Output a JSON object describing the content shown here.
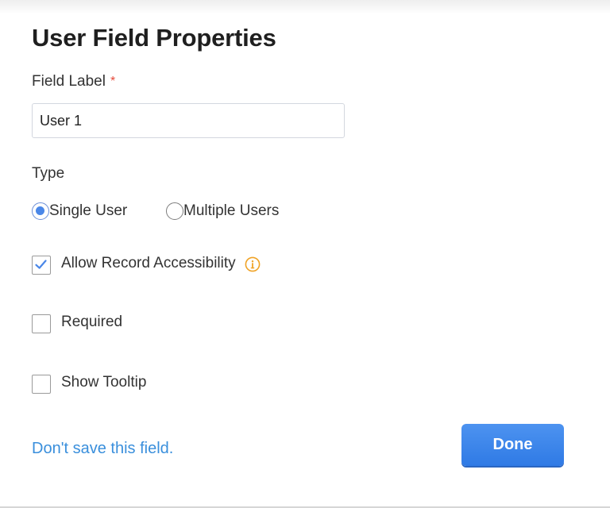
{
  "dialog": {
    "title": "User Field Properties"
  },
  "field_label": {
    "label": "Field Label",
    "required_marker": "*",
    "value": "User 1"
  },
  "type": {
    "label": "Type",
    "options": [
      {
        "label": "Single User",
        "selected": true
      },
      {
        "label": "Multiple Users",
        "selected": false
      }
    ]
  },
  "options": {
    "allow_record_accessibility": {
      "label": "Allow Record Accessibility",
      "checked": true,
      "icon": "info-icon"
    },
    "required": {
      "label": "Required",
      "checked": false
    },
    "show_tooltip": {
      "label": "Show Tooltip",
      "checked": false
    }
  },
  "footer": {
    "dont_save_link": "Don't save this field.",
    "done_label": "Done"
  },
  "colors": {
    "accent": "#4a87e8",
    "link": "#3a8fdc",
    "required": "#e5493a",
    "info": "#f0a326"
  }
}
